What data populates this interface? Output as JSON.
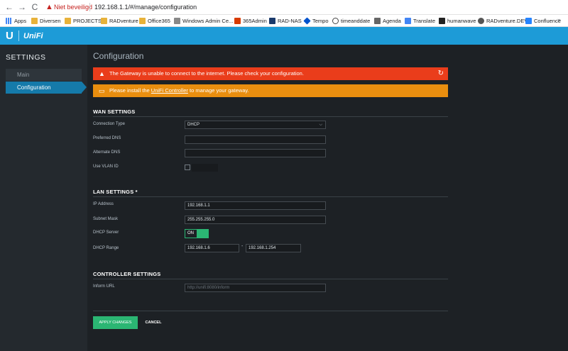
{
  "browser": {
    "back": "←",
    "forward": "→",
    "reload": "C",
    "security_label": "Niet beveiligd",
    "url": "192.168.1.1/#/manage/configuration",
    "bookmarks": [
      "Apps",
      "Diversen",
      "PROJECTS",
      "RADventure",
      "Office365",
      "Windows Admin Ce...",
      "365Admin",
      "RAD-NAS",
      "Tempo",
      "timeanddate",
      "Agenda",
      "Translate",
      "humanwave",
      "RADventure.DEV",
      "Confluence"
    ],
    "bookmarks_more": "»"
  },
  "header": {
    "logo": "U",
    "product": "UniFi"
  },
  "sidebar": {
    "title": "SETTINGS",
    "items": [
      {
        "label": "Main",
        "active": false
      },
      {
        "label": "Configuration",
        "active": true
      }
    ]
  },
  "page": {
    "title": "Configuration",
    "alerts": {
      "gateway": "The Gateway is unable to connect to the internet. Please check your configuration.",
      "controller_pre": "Please install the ",
      "controller_link": "UniFi Controller",
      "controller_post": " to manage your gateway."
    },
    "wan": {
      "title": "WAN SETTINGS",
      "connection_type_label": "Connection Type",
      "connection_type_value": "DHCP",
      "preferred_dns_label": "Preferred DNS",
      "preferred_dns_value": "",
      "alternate_dns_label": "Alternate DNS",
      "alternate_dns_value": "",
      "vlan_label": "Use VLAN ID"
    },
    "lan": {
      "title": "LAN SETTINGS *",
      "ip_label": "IP Address",
      "ip_value": "192.168.1.1",
      "subnet_label": "Subnet Mask",
      "subnet_value": "255.255.255.0",
      "dhcp_server_label": "DHCP Server",
      "dhcp_server_state": "ON",
      "dhcp_range_label": "DHCP Range",
      "dhcp_range_start": "192.168.1.6",
      "dhcp_range_sep": "-",
      "dhcp_range_end": "192.168.1.254"
    },
    "controller": {
      "title": "CONTROLLER SETTINGS",
      "inform_label": "Inform URL",
      "inform_placeholder": "http://unifi:8080/inform"
    },
    "actions": {
      "apply": "APPLY CHANGES",
      "cancel": "CANCEL"
    }
  },
  "colors": {
    "header_blue": "#1d9bd7",
    "active_item": "#157aaa",
    "alert_red": "#ea3d1b",
    "alert_orange": "#e98e0f",
    "success_green": "#2bb673"
  }
}
